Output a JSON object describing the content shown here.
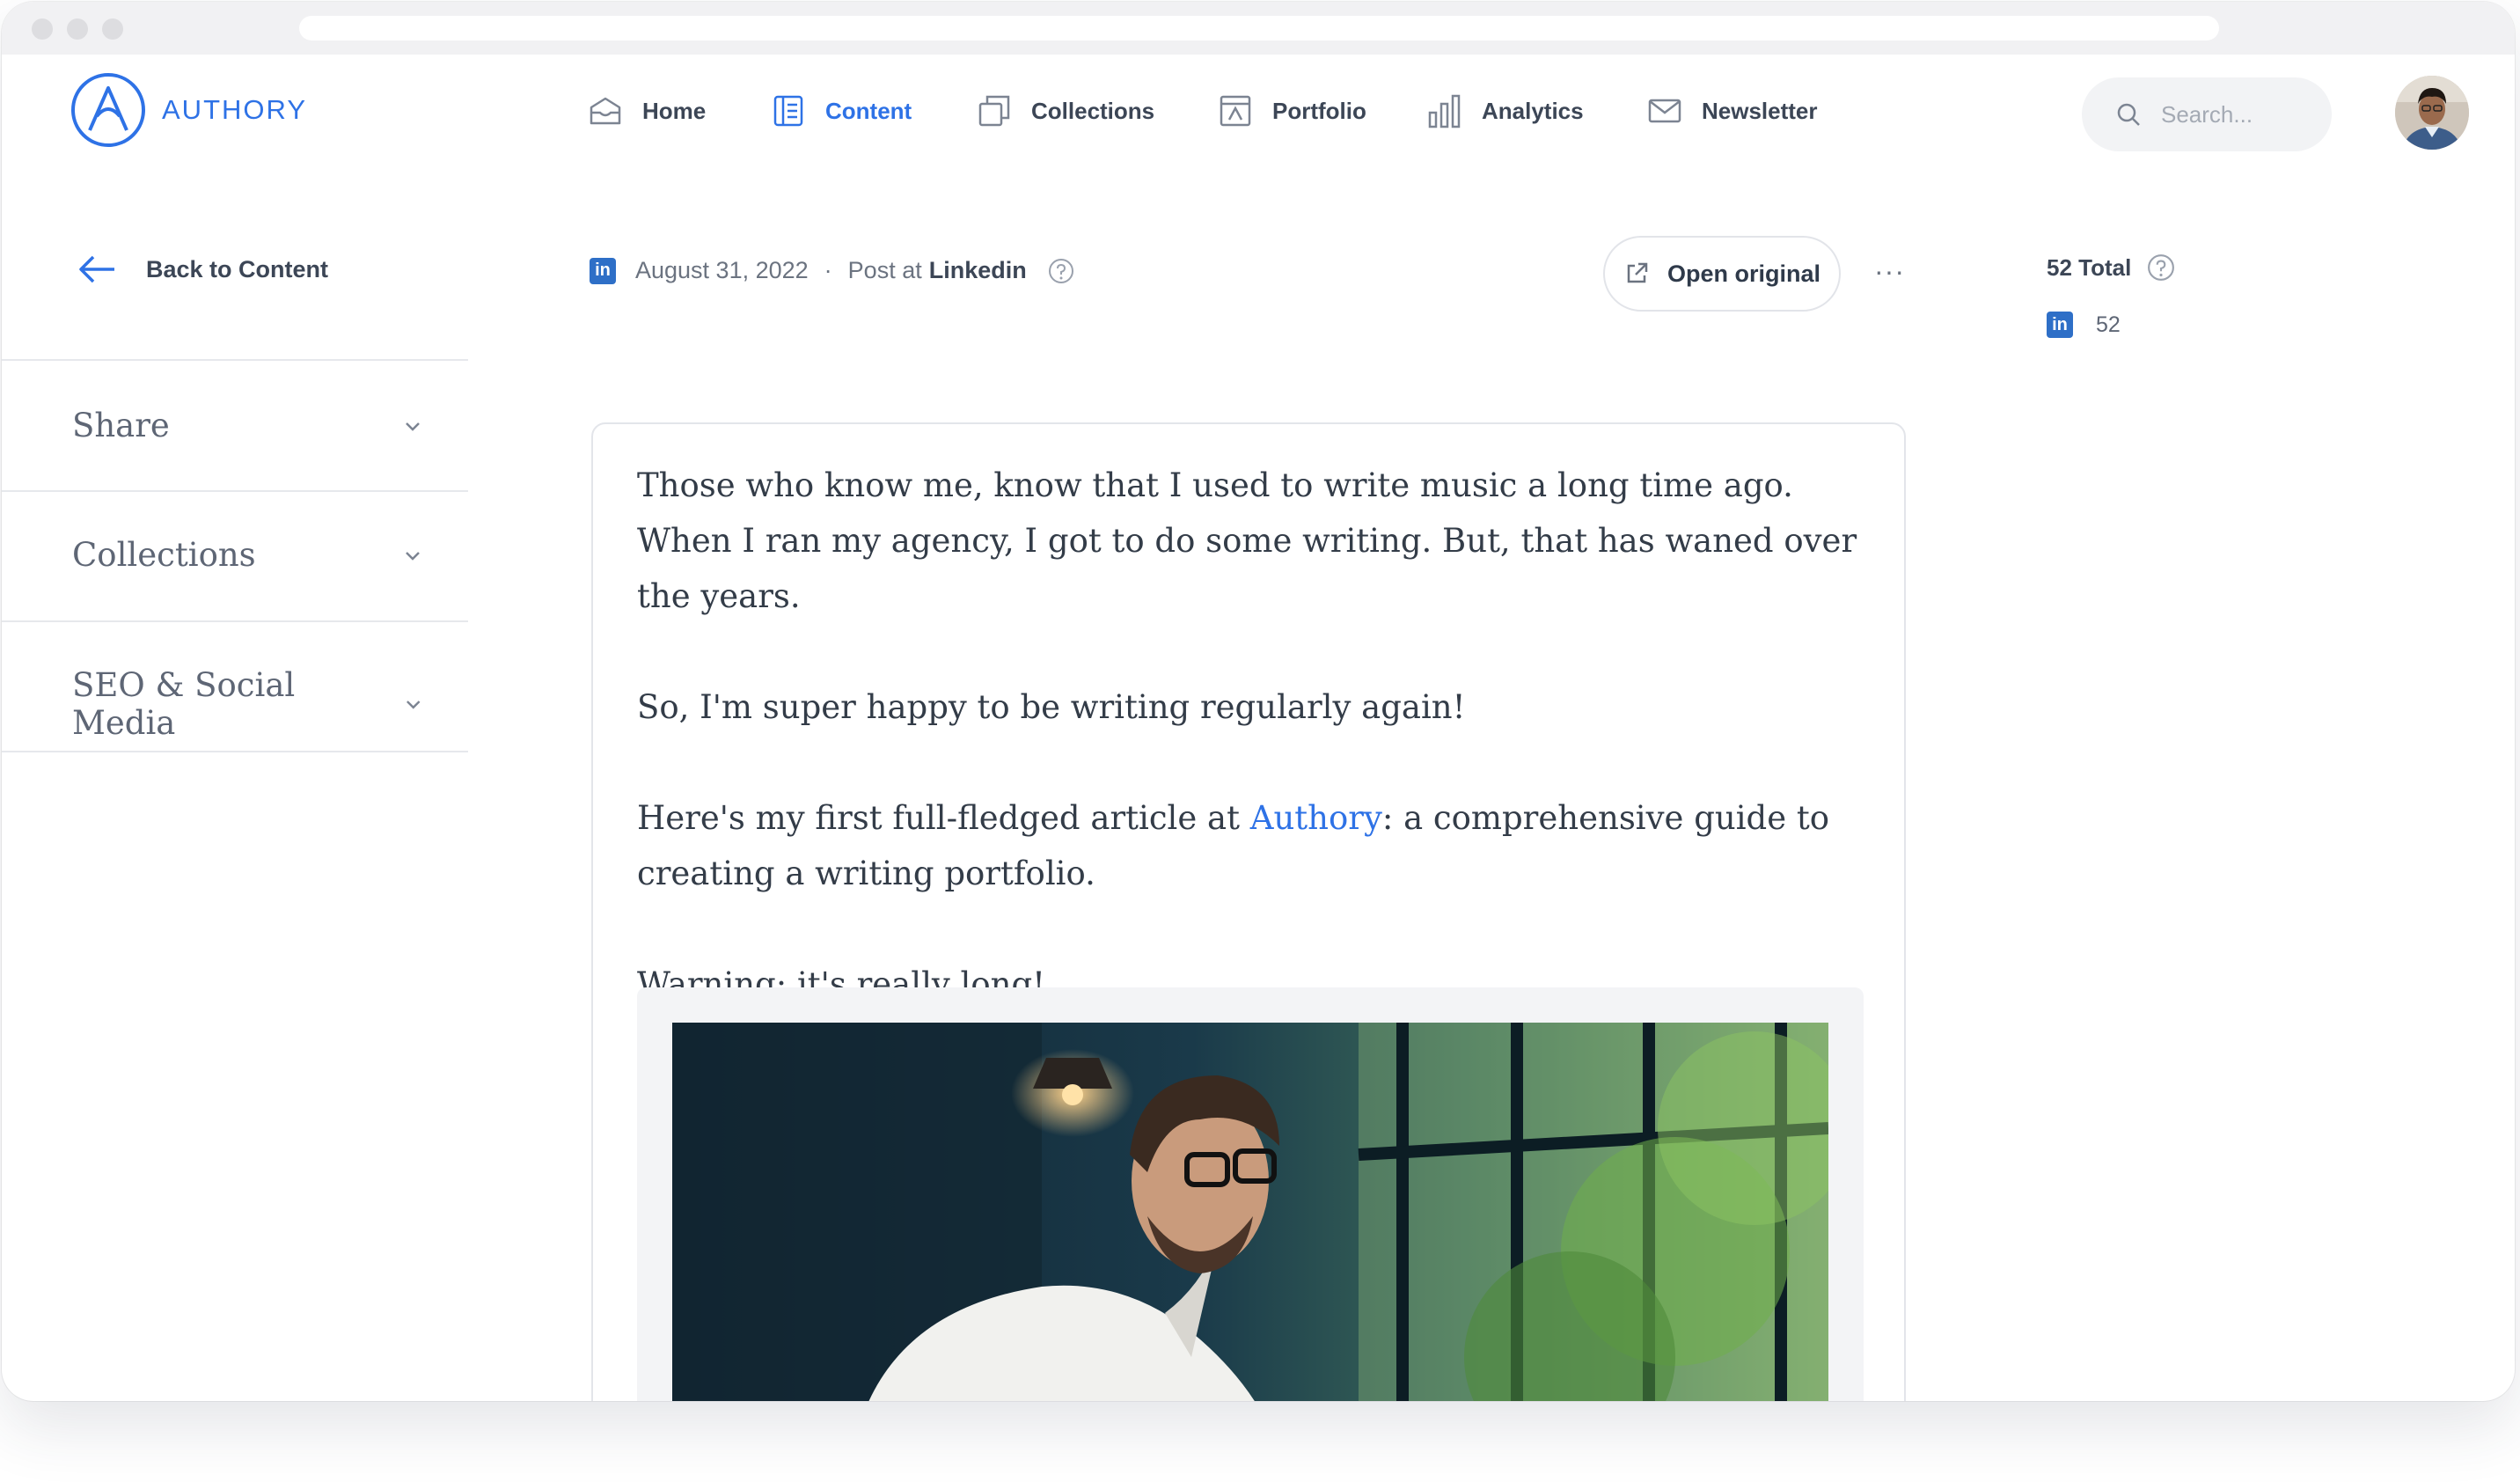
{
  "brand": {
    "name": "AUTHORY",
    "accent": "#2e72e6"
  },
  "nav": {
    "items": [
      {
        "label": "Home",
        "icon": "home-icon"
      },
      {
        "label": "Content",
        "icon": "content-icon",
        "active": true
      },
      {
        "label": "Collections",
        "icon": "collections-icon"
      },
      {
        "label": "Portfolio",
        "icon": "portfolio-icon"
      },
      {
        "label": "Analytics",
        "icon": "analytics-icon"
      },
      {
        "label": "Newsletter",
        "icon": "newsletter-icon"
      }
    ]
  },
  "search": {
    "placeholder": "Search..."
  },
  "sidebar": {
    "back_label": "Back to Content",
    "sections": [
      {
        "label": "Share"
      },
      {
        "label": "Collections"
      },
      {
        "label": "SEO & Social Media"
      }
    ]
  },
  "post": {
    "date": "August 31, 2022",
    "separator": "·",
    "type_prefix": "Post at",
    "platform": "Linkedin",
    "open_original_label": "Open original",
    "more_label": "···",
    "linkedin_badge": "in"
  },
  "stats": {
    "total_label": "52 Total",
    "linkedin_count": "52"
  },
  "article": {
    "p1": "Those who know me, know that I used to write music a long time ago. When I ran my agency, I got to do some writing. But, that has waned over the years.",
    "p2": "So, I'm super happy to be writing regularly again!",
    "p3_before": "Here's my first full-fledged article at ",
    "p3_link": "Authory",
    "p3_after": ": a comprehensive guide to creating a writing portfolio.",
    "p4": "Warning: it's really long!"
  }
}
